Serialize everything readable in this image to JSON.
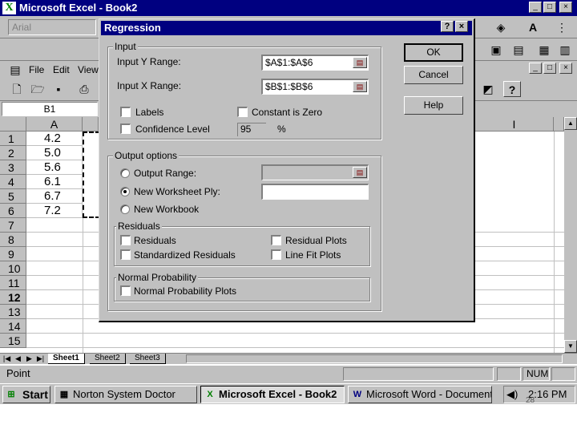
{
  "app": {
    "title": "Microsoft Excel - Book2",
    "window_controls": [
      "_",
      "□",
      "×"
    ]
  },
  "format_toolbar": {
    "font_name": "Arial"
  },
  "menu": {
    "items": [
      "File",
      "Edit",
      "View"
    ]
  },
  "formula_bar": {
    "name_box": "B1"
  },
  "sheet": {
    "columns": [
      "A",
      "I"
    ],
    "rows": [
      "1",
      "2",
      "3",
      "4",
      "5",
      "6",
      "7",
      "8",
      "9",
      "10",
      "11",
      "12",
      "13",
      "14",
      "15"
    ],
    "column_a_values": [
      "4.2",
      "5.0",
      "5.6",
      "6.1",
      "6.7",
      "7.2"
    ],
    "active_row": "12",
    "tabs": [
      "Sheet1",
      "Sheet2",
      "Sheet3"
    ],
    "active_tab": "Sheet1"
  },
  "status_bar": {
    "mode": "Point",
    "num_indicator": "NUM"
  },
  "dialog": {
    "title": "Regression",
    "title_buttons": [
      "?",
      "×"
    ],
    "input_group": "Input",
    "input_y_label": "Input Y Range:",
    "input_y_value": "$A$1:$A$6",
    "input_x_label": "Input X Range:",
    "input_x_value": "$B$1:$B$6",
    "labels_label": "Labels",
    "constant_zero_label": "Constant is Zero",
    "confidence_label": "Confidence Level",
    "confidence_value": "95",
    "percent_sign": "%",
    "output_group": "Output options",
    "output_range_label": "Output Range:",
    "output_range_value": "",
    "new_ply_label": "New Worksheet Ply:",
    "new_ply_value": "",
    "new_workbook_label": "New Workbook",
    "residuals_group": "Residuals",
    "residuals_label": "Residuals",
    "std_residuals_label": "Standardized Residuals",
    "residual_plots_label": "Residual Plots",
    "line_fit_label": "Line Fit Plots",
    "normal_group": "Normal Probability",
    "normal_plots_label": "Normal Probability Plots",
    "ok_label": "OK",
    "cancel_label": "Cancel",
    "help_label": "Help",
    "selected_output": "new_ply"
  },
  "taskbar": {
    "start_label": "Start",
    "tasks": [
      "Norton System Doctor",
      "Microsoft Excel - Book2",
      "Microsoft Word - Document1"
    ],
    "active_task": "Microsoft Excel - Book2",
    "clock": "2:16 PM"
  },
  "slide_number": "28",
  "colors": {
    "title_bar": "#000080",
    "face": "#c0c0c0"
  }
}
